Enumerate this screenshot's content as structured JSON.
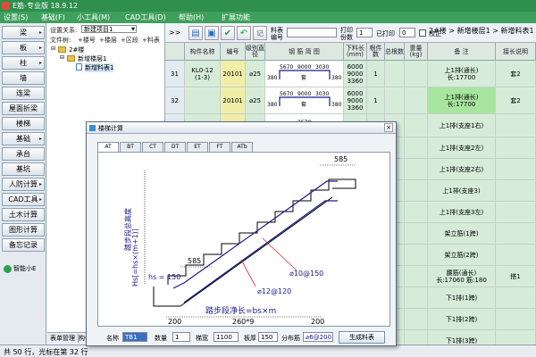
{
  "app": {
    "title": "E筋-专业版 18.9.12"
  },
  "menu": [
    "设置(S)",
    "基础(F)",
    "小工具(M)",
    "CAD工具(D)",
    "帮助(H)",
    "扩展功能"
  ],
  "left_buttons": [
    {
      "label": "梁",
      "arrow": true
    },
    {
      "label": "板",
      "arrow": true
    },
    {
      "label": "柱",
      "arrow": true
    },
    {
      "label": "墙",
      "arrow": false
    },
    {
      "label": "连梁",
      "arrow": false
    },
    {
      "label": "屋面折梁",
      "arrow": false
    },
    {
      "label": "楼梯",
      "arrow": false
    },
    {
      "label": "基础",
      "arrow": true
    },
    {
      "label": "承台",
      "arrow": false
    },
    {
      "label": "基坑",
      "arrow": false
    },
    {
      "label": "人防计算",
      "arrow": true
    },
    {
      "label": "CAD工具",
      "arrow": true
    },
    {
      "label": "土木计算",
      "arrow": false
    },
    {
      "label": "图形计算",
      "arrow": false
    },
    {
      "label": "备忘记录",
      "arrow": false
    }
  ],
  "smart_label": "智能小E",
  "tree_panel": {
    "template_label": "设置关系:",
    "template_value": "新建项目1",
    "file_label": "文件树:",
    "file_ops": [
      "+楼号",
      "+楼层",
      "+区段",
      "+料表"
    ],
    "root": "2#楼",
    "floor": "新增楼层1",
    "sheet": "新增料表1"
  },
  "bottom_tabs": [
    "表单管理",
    "构件"
  ],
  "status": "共 50 行，光标在第 32 行",
  "toolbar": {
    "expand": ">>",
    "sheet_label_1": "料表",
    "sheet_label_2": "编号",
    "print_label": "打印",
    "print_sub": "份数",
    "print_count": "1",
    "printed_label": "已打印",
    "printed_count": "0",
    "check_label": "校正",
    "breadcrumb": "2#楼 > 新增楼层1 > 新增料表1"
  },
  "grid": {
    "headers": [
      "",
      "构件名称",
      "编号",
      "级别直径",
      "钢 筋 简 图",
      "下料长(mm)",
      "根件数",
      "总根数",
      "重量(kg)",
      "备  注",
      "接长说明"
    ],
    "rows": [
      {
        "num": "31",
        "name": "KL0-12\n(1-3)",
        "code": "20101",
        "grade": "⌀25",
        "dims": [
          "5670",
          "9000",
          "3030"
        ],
        "left": "380",
        "right": "380",
        "label": "套",
        "len": "6000\n9000\n3360",
        "qty": "1",
        "tot": "",
        "wt": "",
        "note": "上1排(通长)\n长:17700",
        "x": "套2"
      },
      {
        "num": "32",
        "name": "",
        "code": "20101",
        "grade": "⌀25",
        "dims": [
          "5670",
          "9000",
          "3030"
        ],
        "left": "380",
        "right": "380",
        "label": "套",
        "len": "6000\n9000\n3360",
        "qty": "1",
        "tot": "",
        "wt": "",
        "note": "上1排(通长)\n长:17700",
        "x": "套2"
      },
      {
        "num": "",
        "name": "",
        "code": "20100",
        "grade": "⌀25",
        "dims": [
          "3570"
        ],
        "left": "",
        "right": "",
        "label": "",
        "len": "3900",
        "qty": "",
        "tot": "",
        "wt": "",
        "note": "上1排(支座1右)",
        "x": ""
      },
      {
        "num": "",
        "name": "",
        "code": "",
        "grade": "",
        "dims": [],
        "left": "",
        "right": "",
        "label": "",
        "len": "",
        "qty": "",
        "tot": "",
        "wt": "",
        "note": "上1排(支座2左)",
        "x": ""
      },
      {
        "num": "",
        "name": "",
        "code": "",
        "grade": "",
        "dims": [],
        "left": "",
        "right": "",
        "label": "",
        "len": "",
        "qty": "",
        "tot": "",
        "wt": "",
        "note": "上1排(支座2右)",
        "x": ""
      },
      {
        "num": "",
        "name": "",
        "code": "",
        "grade": "",
        "dims": [],
        "left": "",
        "right": "",
        "label": "",
        "len": "",
        "qty": "",
        "tot": "",
        "wt": "",
        "note": "上1排(支座3)",
        "x": ""
      },
      {
        "num": "",
        "name": "",
        "code": "",
        "grade": "",
        "dims": [],
        "left": "",
        "right": "",
        "label": "",
        "len": "",
        "qty": "",
        "tot": "",
        "wt": "",
        "note": "上1排(支座3左)",
        "x": ""
      },
      {
        "num": "",
        "name": "",
        "code": "",
        "grade": "",
        "dims": [],
        "left": "",
        "right": "",
        "label": "",
        "len": "",
        "qty": "",
        "tot": "",
        "wt": "",
        "note": "架立筋(1跨)",
        "x": ""
      },
      {
        "num": "",
        "name": "",
        "code": "",
        "grade": "",
        "dims": [],
        "left": "",
        "right": "",
        "label": "",
        "len": "",
        "qty": "",
        "tot": "",
        "wt": "",
        "note": "架立筋(2跨)",
        "x": ""
      },
      {
        "num": "",
        "name": "",
        "code": "",
        "grade": "",
        "dims": [],
        "left": "",
        "right": "",
        "label": "",
        "len": "",
        "qty": "",
        "tot": "",
        "wt": "",
        "note": "腰筋(通长)\n长:17060 筋:180",
        "x": "搭1"
      },
      {
        "num": "",
        "name": "",
        "code": "",
        "grade": "",
        "dims": [],
        "left": "",
        "right": "",
        "label": "",
        "len": "",
        "qty": "",
        "tot": "",
        "wt": "",
        "note": "下1排(1跨)",
        "x": ""
      },
      {
        "num": "",
        "name": "",
        "code": "",
        "grade": "",
        "dims": [],
        "left": "",
        "right": "",
        "label": "",
        "len": "",
        "qty": "",
        "tot": "",
        "wt": "",
        "note": "下1排(2跨)",
        "x": ""
      },
      {
        "num": "",
        "name": "",
        "code": "",
        "grade": "",
        "dims": [],
        "left": "",
        "right": "",
        "label": "",
        "len": "",
        "qty": "",
        "tot": "",
        "wt": "",
        "note": "下1排(3跨)",
        "x": ""
      }
    ]
  },
  "dialog": {
    "title": "楼梯计算",
    "close": "×",
    "tabs": [
      "AT",
      "BT",
      "CT",
      "DT",
      "ET",
      "FT",
      "ATb"
    ],
    "active_tab": "AT",
    "drawing": {
      "top_dim": "585",
      "mid_dim": "585",
      "rebar_a": "⌀10@150",
      "rebar_b": "⌀12@120",
      "hs_label": "hs = 150",
      "vertical_label": "Hs[=hs×(m+1)]",
      "vertical_sub": "踏步段总高度",
      "length_label": "踏步段净长=bs×m",
      "bottom_left": "200",
      "bottom_mid": "260*9",
      "bottom_right": "200"
    },
    "fields": {
      "name_label": "名称",
      "name_value": "TB1",
      "qty_label": "数量",
      "qty_value": "1",
      "width_label": "梯宽",
      "width_value": "1100",
      "thick_label": "板厚",
      "thick_value": "150",
      "dist_label": "分布筋",
      "dist_value": "⌀6@200",
      "generate": "生成料表"
    }
  }
}
